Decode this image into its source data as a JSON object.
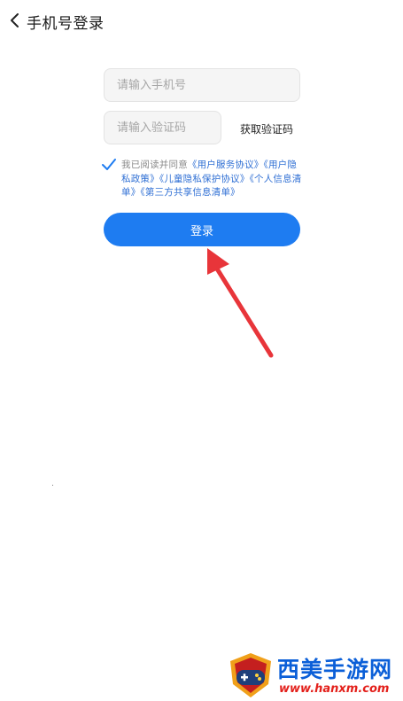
{
  "header": {
    "title": "手机号登录",
    "back_icon": "chevron-left-icon"
  },
  "form": {
    "phone_placeholder": "请输入手机号",
    "code_placeholder": "请输入验证码",
    "get_code_label": "获取验证码",
    "login_label": "登录"
  },
  "agreement": {
    "checked": true,
    "prefix": "我已阅读并同意",
    "links": [
      "《用户服务协议》",
      "《用户隐私政策》",
      "《儿童隐私保护协议》",
      "《个人信息清单》",
      "《第三方共享信息清单》"
    ]
  },
  "watermark": {
    "name": "西美手游网",
    "url": "www.hanxm.com"
  },
  "colors": {
    "accent": "#1e7cf1",
    "link": "#2f6fd4",
    "arrow": "#e8353a"
  }
}
